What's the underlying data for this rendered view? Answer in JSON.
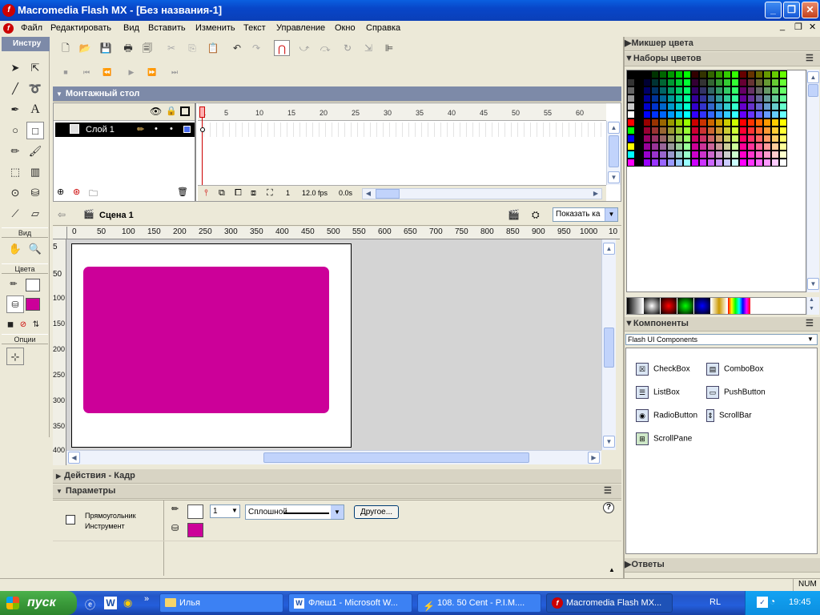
{
  "window": {
    "title": "Macromedia Flash MX - [Без названия-1]",
    "logo_glyph": "f",
    "buttons": {
      "minimize": "_",
      "restore": "❐",
      "close": "✕"
    }
  },
  "menu": {
    "items": [
      "Файл",
      "Редактировать",
      "Вид",
      "Вставить",
      "Изменить",
      "Текст",
      "Управление",
      "Окно",
      "Справка"
    ],
    "doc_controls": [
      "_",
      "❐",
      "✕"
    ]
  },
  "toolbox": {
    "header": "Инстру",
    "sections": {
      "view": "Вид",
      "colors": "Цвета",
      "options": "Опции"
    },
    "stroke_color": "#ffffff",
    "fill_color": "#cc0099"
  },
  "timeline": {
    "header": "Монтажный стол",
    "layer_name": "Слой 1",
    "frame_numbers": [
      "1",
      "5",
      "10",
      "15",
      "20",
      "25",
      "30",
      "35",
      "40",
      "45",
      "50",
      "55",
      "60"
    ],
    "current_frame": "1",
    "fps": "12.0 fps",
    "time": "0.0s"
  },
  "stage_bar": {
    "scene": "Сцена 1",
    "zoom": "Показать ка"
  },
  "ruler": {
    "h": [
      "0",
      "50",
      "100",
      "150",
      "200",
      "250",
      "300",
      "350",
      "400",
      "450",
      "500",
      "550",
      "600",
      "650",
      "700",
      "750",
      "800",
      "850",
      "900",
      "950",
      "1000",
      "10"
    ],
    "v": [
      "5",
      "50",
      "100",
      "150",
      "200",
      "250",
      "300",
      "350",
      "400"
    ]
  },
  "stage": {
    "rect_color": "#cc0099"
  },
  "panels": {
    "actions": "Действия - Кадр",
    "params": "Параметры",
    "color_mixer": "Микшер цвета",
    "swatches": "Наборы цветов",
    "components": "Компоненты",
    "answers": "Ответы"
  },
  "params": {
    "tool_name": "Прямоугольник",
    "tool_sub": "Инструмент",
    "stroke_width": "1",
    "stroke_style": "Сплошной",
    "other_button": "Другое...",
    "help": "?"
  },
  "components": {
    "set": "Flash UI Components",
    "items": [
      {
        "label": "CheckBox",
        "icon": "checkbox-icon"
      },
      {
        "label": "ComboBox",
        "icon": "combobox-icon"
      },
      {
        "label": "ListBox",
        "icon": "listbox-icon"
      },
      {
        "label": "PushButton",
        "icon": "pushbutton-icon"
      },
      {
        "label": "RadioButton",
        "icon": "radiobutton-icon"
      },
      {
        "label": "ScrollBar",
        "icon": "scrollbar-icon"
      },
      {
        "label": "ScrollPane",
        "icon": "scrollpane-icon"
      }
    ]
  },
  "status": {
    "num": "NUM"
  },
  "taskbar": {
    "start": "пуск",
    "tasks": [
      "Илья",
      "Флеш1 - Microsoft W...",
      "108. 50 Cent - P.I.M....",
      "Macromedia Flash MX..."
    ],
    "lang": "RL",
    "clock": "19:45"
  }
}
